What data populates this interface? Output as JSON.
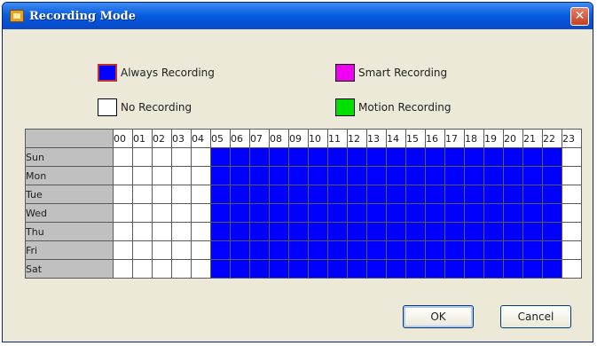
{
  "window": {
    "title": "Recording Mode",
    "close_glyph": "✕"
  },
  "legend": [
    {
      "label": "Always Recording",
      "color": "#0000fc"
    },
    {
      "label": "Smart Recording",
      "color": "#f000f0"
    },
    {
      "label": "No Recording",
      "color": "#ffffff"
    },
    {
      "label": "Motion Recording",
      "color": "#00e000"
    }
  ],
  "schedule": {
    "hours": [
      "00",
      "01",
      "02",
      "03",
      "04",
      "05",
      "06",
      "07",
      "08",
      "09",
      "10",
      "11",
      "12",
      "13",
      "14",
      "15",
      "16",
      "17",
      "18",
      "19",
      "20",
      "21",
      "22",
      "23"
    ],
    "days": [
      "Sun",
      "Mon",
      "Tue",
      "Wed",
      "Thu",
      "Fri",
      "Sat"
    ],
    "always_recording_hours": [
      5,
      6,
      7,
      8,
      9,
      10,
      11,
      12,
      13,
      14,
      15,
      16,
      17,
      18,
      19,
      20,
      21,
      22
    ],
    "always_color": "#0000fc",
    "none_color": "#ffffff"
  },
  "buttons": {
    "ok": "OK",
    "cancel": "Cancel"
  }
}
